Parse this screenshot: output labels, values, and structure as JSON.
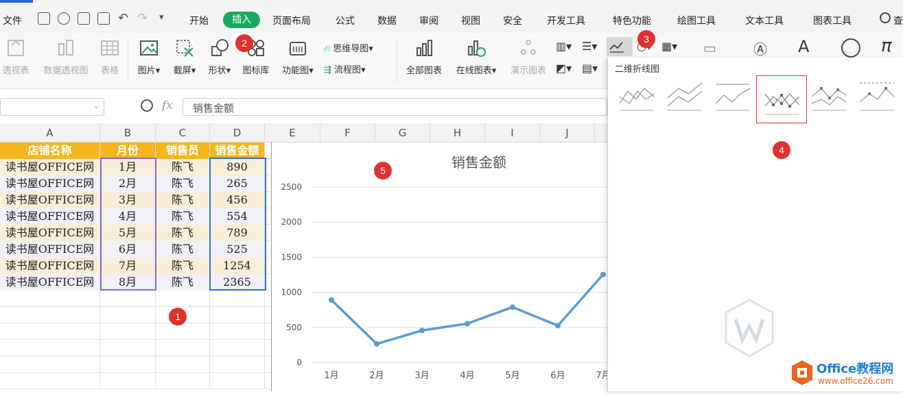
{
  "menu": {
    "file": "文件",
    "tabs": [
      "开始",
      "插入",
      "页面布局",
      "公式",
      "数据",
      "审阅",
      "视图",
      "安全",
      "开发工具",
      "特色功能",
      "绘图工具",
      "文本工具",
      "图表工具"
    ],
    "search_partial": "查"
  },
  "ribbon": {
    "pivot_table": "透视表",
    "pivot_chart": "数据透视图",
    "table": "表格",
    "picture": "图片",
    "screenshot": "截屏",
    "shapes": "形状",
    "icon_library": "图标库",
    "func_chart": "功能图",
    "mindmap": "思维导图",
    "flowchart": "流程图",
    "all_charts": "全部图表",
    "online_charts": "在线图表",
    "demo_chart": "演示图表"
  },
  "formula_bar": {
    "fx": "fx",
    "value": "销售金额"
  },
  "columns": [
    "A",
    "B",
    "C",
    "D",
    "E",
    "F",
    "G",
    "H",
    "I",
    "J"
  ],
  "sheet": {
    "headers": [
      "店铺名称",
      "月份",
      "销售员",
      "销售金额"
    ],
    "rows": [
      [
        "读书屋OFFICE网",
        "1月",
        "陈飞",
        "890"
      ],
      [
        "读书屋OFFICE网",
        "2月",
        "陈飞",
        "265"
      ],
      [
        "读书屋OFFICE网",
        "3月",
        "陈飞",
        "456"
      ],
      [
        "读书屋OFFICE网",
        "4月",
        "陈飞",
        "554"
      ],
      [
        "读书屋OFFICE网",
        "5月",
        "陈飞",
        "789"
      ],
      [
        "读书屋OFFICE网",
        "6月",
        "陈飞",
        "525"
      ],
      [
        "读书屋OFFICE网",
        "7月",
        "陈飞",
        "1254"
      ],
      [
        "读书屋OFFICE网",
        "8月",
        "陈飞",
        "2365"
      ]
    ]
  },
  "popup": {
    "title": "二维折线图"
  },
  "badges": [
    "1",
    "2",
    "3",
    "4",
    "5"
  ],
  "watermark": {
    "brand": "Office教程网",
    "url": "www.office26.com"
  },
  "colors": {
    "accent_green": "#1aa860",
    "header_fill": "#f5b51e",
    "line_series": "#5b9bd5",
    "badge_red": "#e03030"
  },
  "chart_data": {
    "type": "line",
    "title": "销售金额",
    "categories": [
      "1月",
      "2月",
      "3月",
      "4月",
      "5月",
      "6月",
      "7月"
    ],
    "values": [
      890,
      265,
      456,
      554,
      789,
      525,
      1254
    ],
    "yticks": [
      0,
      500,
      1000,
      1500,
      2000,
      2500
    ],
    "ylim": [
      0,
      2500
    ],
    "grid": true
  }
}
